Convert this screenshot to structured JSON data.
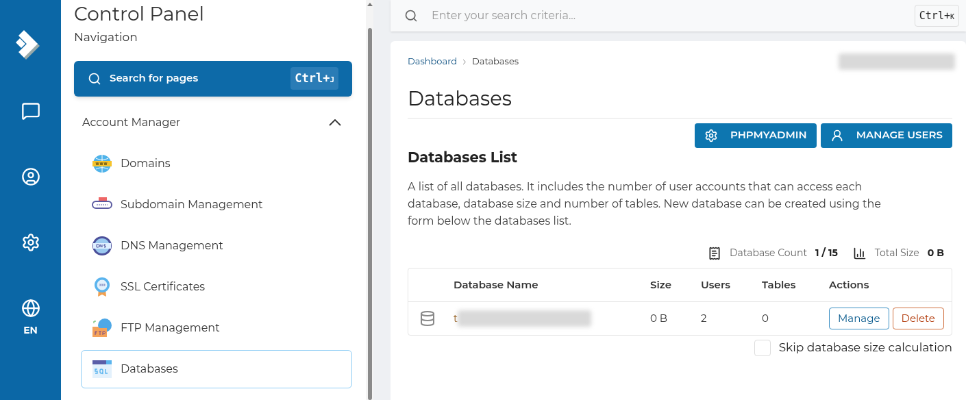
{
  "rail": {
    "items": [
      {
        "kind": "chat"
      },
      {
        "kind": "user"
      },
      {
        "kind": "settings"
      },
      {
        "kind": "language",
        "label": "EN"
      }
    ]
  },
  "sidebar": {
    "title": "Control Panel",
    "subtitle": "Navigation",
    "search": {
      "placeholder": "Search for pages",
      "shortcut": "Ctrl+",
      "shortcut_key": "J"
    },
    "section": {
      "label": "Account Manager",
      "expanded": true,
      "items": [
        {
          "label": "Domains",
          "kind": "www",
          "selected": false
        },
        {
          "label": "Subdomain Management",
          "kind": "subdomain",
          "selected": false
        },
        {
          "label": "DNS Management",
          "kind": "dns",
          "selected": false
        },
        {
          "label": "SSL Certificates",
          "kind": "ssl",
          "selected": false
        },
        {
          "label": "FTP Management",
          "kind": "ftp",
          "selected": false
        },
        {
          "label": "Databases",
          "kind": "sql",
          "selected": true
        }
      ]
    }
  },
  "topbar": {
    "search": {
      "placeholder": "Enter your search criteria...",
      "shortcut": "Ctrl+",
      "shortcut_key": "K"
    }
  },
  "breadcrumb": [
    "Dashboard",
    "Databases"
  ],
  "page_title": "Databases",
  "actions": [
    {
      "label": "PHPMYADMIN",
      "kind": "settings"
    },
    {
      "label": "MANAGE USERS",
      "kind": "user"
    }
  ],
  "list": {
    "title": "Databases List",
    "description": "A list of all databases. It includes the number of user accounts that can access each database, database size and number of tables. New database can be created using the form below the databases list.",
    "stats": [
      {
        "kind": "receipt",
        "label": "Database Count",
        "value": "1 / 15"
      },
      {
        "kind": "chart",
        "label": "Total Size",
        "value": "0 B"
      }
    ],
    "table": {
      "columns": [
        "Database Name",
        "Size",
        "Users",
        "Tables",
        "Actions"
      ],
      "rows": [
        {
          "name_prefix": "t",
          "size": "0 B",
          "users": "2",
          "tables": "0",
          "buttons": [
            {
              "label": "Manage",
              "kind": "primary"
            },
            {
              "label": "Delete",
              "kind": "danger"
            }
          ]
        }
      ]
    },
    "skip_size": {
      "label": "Skip database size calculation",
      "checked": false
    }
  }
}
